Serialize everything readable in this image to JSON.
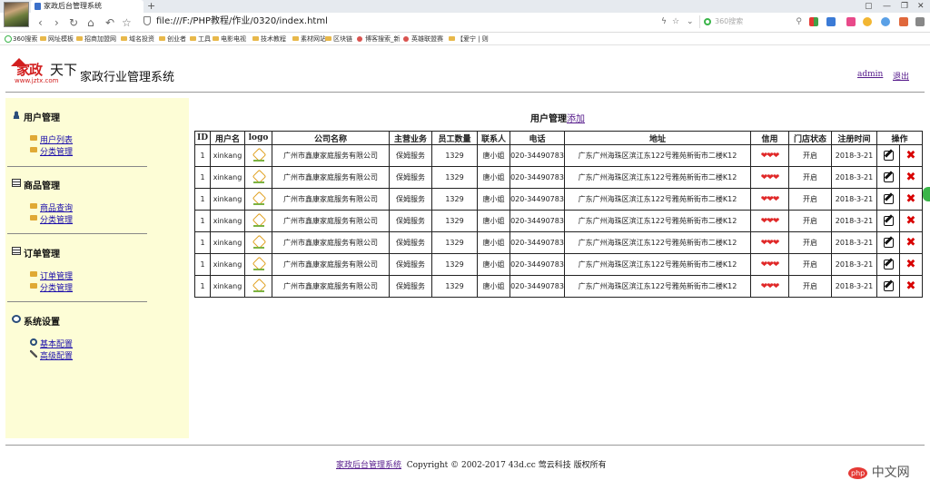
{
  "browser": {
    "tab_title": "家政后台管理系统",
    "new_tab": "+",
    "url": "file:///F:/PHP教程/作业/0320/index.html",
    "search_placeholder": "360搜索",
    "bookmarks": [
      "360搜索",
      "网址模板",
      "招商加盟网",
      "域名投资",
      "创业者",
      "工具",
      "电影电视",
      "技术教程",
      "素材网站",
      "区块链",
      "博客搜索_新",
      "英雄联盟赛",
      "【爱宁 | 则"
    ]
  },
  "header": {
    "logo_text_red": "家政",
    "logo_text_black": "天下",
    "logo_url": "www.jztx.com",
    "site_title": "家政行业管理系统",
    "user_link": "admin",
    "logout_link": "退出"
  },
  "sidebar": {
    "sections": [
      {
        "title": "用户管理",
        "items": [
          "用户列表",
          "分类管理"
        ]
      },
      {
        "title": "商品管理",
        "items": [
          "商品查询",
          "分类管理"
        ]
      },
      {
        "title": "订单管理",
        "items": [
          "订单管理",
          "分类管理"
        ]
      },
      {
        "title": "系统设置",
        "items": [
          "基本配置",
          "高级配置"
        ]
      }
    ]
  },
  "main": {
    "title": "用户管理",
    "add_link": "添加",
    "columns": [
      "ID",
      "用户名",
      "logo",
      "公司名称",
      "主营业务",
      "员工数量",
      "联系人",
      "电话",
      "地址",
      "信用",
      "门店状态",
      "注册时间",
      "操作"
    ],
    "rows": [
      {
        "id": "1",
        "username": "xinkang",
        "company": "广州市鑫康家庭服务有限公司",
        "business": "保姆服务",
        "staff": "1329",
        "contact": "唐小姐",
        "phone": "020-34490783",
        "address": "广东广州海珠区滨江东122号雅苑新街市二楼K12",
        "credit": "❤❤❤",
        "status": "开启",
        "date": "2018-3-21"
      },
      {
        "id": "1",
        "username": "xinkang",
        "company": "广州市鑫康家庭服务有限公司",
        "business": "保姆服务",
        "staff": "1329",
        "contact": "唐小姐",
        "phone": "020-34490783",
        "address": "广东广州海珠区滨江东122号雅苑新街市二楼K12",
        "credit": "❤❤❤",
        "status": "开启",
        "date": "2018-3-21"
      },
      {
        "id": "1",
        "username": "xinkang",
        "company": "广州市鑫康家庭服务有限公司",
        "business": "保姆服务",
        "staff": "1329",
        "contact": "唐小姐",
        "phone": "020-34490783",
        "address": "广东广州海珠区滨江东122号雅苑新街市二楼K12",
        "credit": "❤❤❤",
        "status": "开启",
        "date": "2018-3-21"
      },
      {
        "id": "1",
        "username": "xinkang",
        "company": "广州市鑫康家庭服务有限公司",
        "business": "保姆服务",
        "staff": "1329",
        "contact": "唐小姐",
        "phone": "020-34490783",
        "address": "广东广州海珠区滨江东122号雅苑新街市二楼K12",
        "credit": "❤❤❤",
        "status": "开启",
        "date": "2018-3-21"
      },
      {
        "id": "1",
        "username": "xinkang",
        "company": "广州市鑫康家庭服务有限公司",
        "business": "保姆服务",
        "staff": "1329",
        "contact": "唐小姐",
        "phone": "020-34490783",
        "address": "广东广州海珠区滨江东122号雅苑新街市二楼K12",
        "credit": "❤❤❤",
        "status": "开启",
        "date": "2018-3-21"
      },
      {
        "id": "1",
        "username": "xinkang",
        "company": "广州市鑫康家庭服务有限公司",
        "business": "保姆服务",
        "staff": "1329",
        "contact": "唐小姐",
        "phone": "020-34490783",
        "address": "广东广州海珠区滨江东122号雅苑新街市二楼K12",
        "credit": "❤❤❤",
        "status": "开启",
        "date": "2018-3-21"
      },
      {
        "id": "1",
        "username": "xinkang",
        "company": "广州市鑫康家庭服务有限公司",
        "business": "保姆服务",
        "staff": "1329",
        "contact": "唐小姐",
        "phone": "020-34490783",
        "address": "广东广州海珠区滨江东122号雅苑新街市二楼K12",
        "credit": "❤❤❤",
        "status": "开启",
        "date": "2018-3-21"
      }
    ]
  },
  "footer": {
    "link": "家政后台管理系统",
    "copyright": "Copyright © 2002-2017 43d.cc 莺云科技 版权所有"
  },
  "watermark": {
    "badge": "php",
    "text": "中文网"
  },
  "colors": {
    "sidebar_bg": "#fdfdd6",
    "credit_heart": "#e02828",
    "delete": "#d80000",
    "logo_red": "#d21f1f"
  }
}
